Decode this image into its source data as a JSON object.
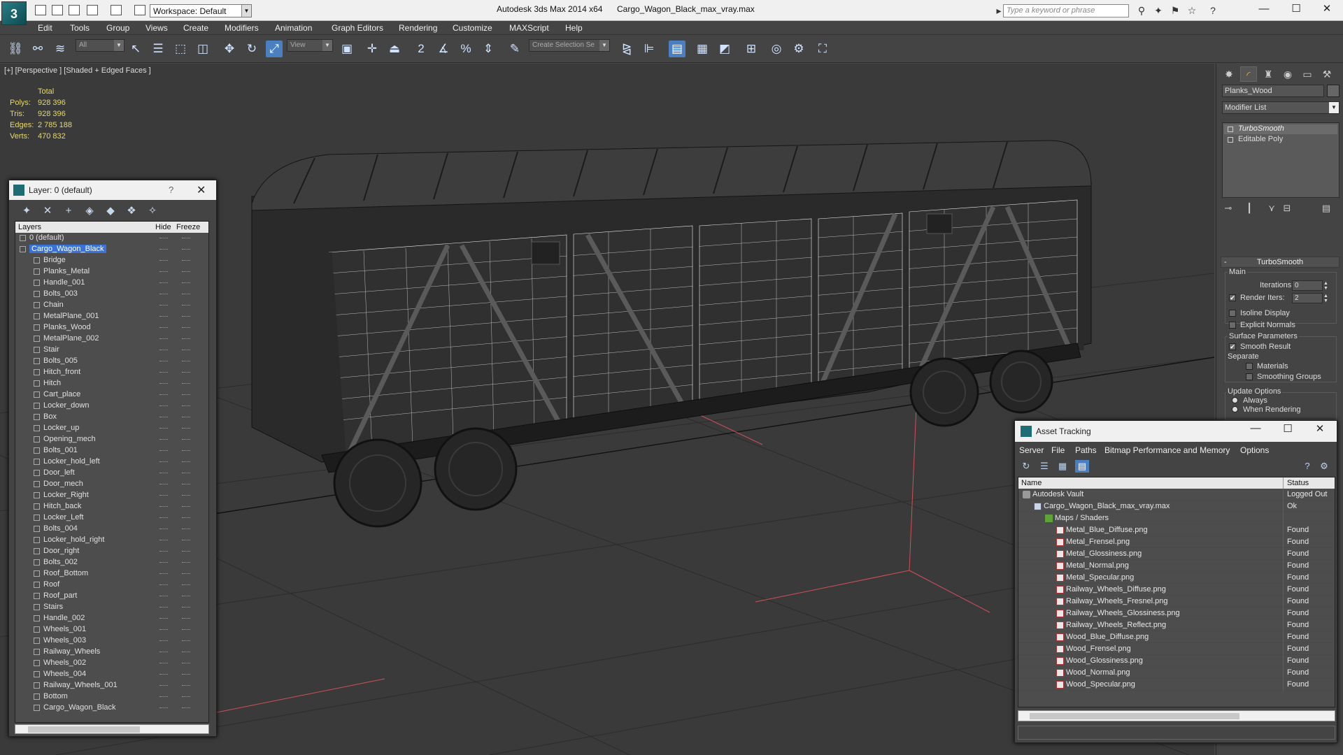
{
  "titlebar": {
    "workspace": "Workspace: Default",
    "app_title": "Autodesk 3ds Max 2014 x64",
    "file_name": "Cargo_Wagon_Black_max_vray.max",
    "search_placeholder": "Type a keyword or phrase"
  },
  "menu": [
    "Edit",
    "Tools",
    "Group",
    "Views",
    "Create",
    "Modifiers",
    "Animation",
    "Graph Editors",
    "Rendering",
    "Customize",
    "MAXScript",
    "Help"
  ],
  "toolbar": {
    "selection_filter": "All",
    "reference_coord": "View",
    "named_selection": "Create Selection Se"
  },
  "viewport": {
    "label": "[+] [Perspective ] [Shaded + Edged Faces ]",
    "stats_title": "Total",
    "stats": [
      {
        "key": "Polys:",
        "value": "928 396"
      },
      {
        "key": "Tris:",
        "value": "928 396"
      },
      {
        "key": "Edges:",
        "value": "2 785 188"
      },
      {
        "key": "Verts:",
        "value": "470 832"
      }
    ]
  },
  "layer_panel": {
    "title": "Layer: 0 (default)",
    "help": "?",
    "columns": {
      "layers": "Layers",
      "hide": "Hide",
      "freeze": "Freeze"
    },
    "rows": [
      {
        "name": "0 (default)",
        "level": 0,
        "selected": false
      },
      {
        "name": "Cargo_Wagon_Black",
        "level": 0,
        "selected": true
      },
      {
        "name": "Bridge",
        "level": 1
      },
      {
        "name": "Planks_Metal",
        "level": 1
      },
      {
        "name": "Handle_001",
        "level": 1
      },
      {
        "name": "Bolts_003",
        "level": 1
      },
      {
        "name": "Chain",
        "level": 1
      },
      {
        "name": "MetalPlane_001",
        "level": 1
      },
      {
        "name": "Planks_Wood",
        "level": 1
      },
      {
        "name": "MetalPlane_002",
        "level": 1
      },
      {
        "name": "Stair",
        "level": 1
      },
      {
        "name": "Bolts_005",
        "level": 1
      },
      {
        "name": "Hitch_front",
        "level": 1
      },
      {
        "name": "Hitch",
        "level": 1
      },
      {
        "name": "Cart_place",
        "level": 1
      },
      {
        "name": "Locker_down",
        "level": 1
      },
      {
        "name": "Box",
        "level": 1
      },
      {
        "name": "Locker_up",
        "level": 1
      },
      {
        "name": "Opening_mech",
        "level": 1
      },
      {
        "name": "Bolts_001",
        "level": 1
      },
      {
        "name": "Locker_hold_left",
        "level": 1
      },
      {
        "name": "Door_left",
        "level": 1
      },
      {
        "name": "Door_mech",
        "level": 1
      },
      {
        "name": "Locker_Right",
        "level": 1
      },
      {
        "name": "Hitch_back",
        "level": 1
      },
      {
        "name": "Locker_Left",
        "level": 1
      },
      {
        "name": "Bolts_004",
        "level": 1
      },
      {
        "name": "Locker_hold_right",
        "level": 1
      },
      {
        "name": "Door_right",
        "level": 1
      },
      {
        "name": "Bolts_002",
        "level": 1
      },
      {
        "name": "Roof_Bottom",
        "level": 1
      },
      {
        "name": "Roof",
        "level": 1
      },
      {
        "name": "Roof_part",
        "level": 1
      },
      {
        "name": "Stairs",
        "level": 1
      },
      {
        "name": "Handle_002",
        "level": 1
      },
      {
        "name": "Wheels_001",
        "level": 1
      },
      {
        "name": "Wheels_003",
        "level": 1
      },
      {
        "name": "Railway_Wheels",
        "level": 1
      },
      {
        "name": "Wheels_002",
        "level": 1
      },
      {
        "name": "Wheels_004",
        "level": 1
      },
      {
        "name": "Railway_Wheels_001",
        "level": 1
      },
      {
        "name": "Bottom",
        "level": 1
      },
      {
        "name": "Cargo_Wagon_Black",
        "level": 1
      }
    ]
  },
  "command_panel": {
    "object_name": "Planks_Wood",
    "modifier_list": "Modifier List",
    "stack": [
      "TurboSmooth",
      "Editable Poly"
    ],
    "rollout_title": "TurboSmooth",
    "main_group": "Main",
    "iterations_label": "Iterations:",
    "iterations_value": "0",
    "render_iters_label": "Render Iters:",
    "render_iters_value": "2",
    "render_iters_checked": "✔",
    "isoline_label": "Isoline Display",
    "explicit_normals_label": "Explicit Normals",
    "surface_params_label": "Surface Parameters",
    "smooth_result_label": "Smooth Result",
    "smooth_result_checked": "✔",
    "separate_label": "Separate",
    "materials_label": "Materials",
    "smoothing_groups_label": "Smoothing Groups",
    "update_options_label": "Update Options",
    "always_label": "Always",
    "when_rendering_label": "When Rendering"
  },
  "asset_tracking": {
    "title": "Asset Tracking",
    "menu": [
      "Server",
      "File",
      "Paths",
      "Bitmap Performance and Memory",
      "Options"
    ],
    "columns": {
      "name": "Name",
      "status": "Status"
    },
    "rows": [
      {
        "name": "Autodesk Vault",
        "status": "Logged Out",
        "type": "vault",
        "level": 0
      },
      {
        "name": "Cargo_Wagon_Black_max_vray.max",
        "status": "Ok",
        "type": "max",
        "level": 1
      },
      {
        "name": "Maps / Shaders",
        "status": "",
        "type": "maps",
        "level": 2
      },
      {
        "name": "Metal_Blue_Diffuse.png",
        "status": "Found",
        "type": "png",
        "level": 3
      },
      {
        "name": "Metal_Frensel.png",
        "status": "Found",
        "type": "png",
        "level": 3
      },
      {
        "name": "Metal_Glossiness.png",
        "status": "Found",
        "type": "png",
        "level": 3
      },
      {
        "name": "Metal_Normal.png",
        "status": "Found",
        "type": "png",
        "level": 3
      },
      {
        "name": "Metal_Specular.png",
        "status": "Found",
        "type": "png",
        "level": 3
      },
      {
        "name": "Railway_Wheels_Diffuse.png",
        "status": "Found",
        "type": "png",
        "level": 3
      },
      {
        "name": "Railway_Wheels_Fresnel.png",
        "status": "Found",
        "type": "png",
        "level": 3
      },
      {
        "name": "Railway_Wheels_Glossiness.png",
        "status": "Found",
        "type": "png",
        "level": 3
      },
      {
        "name": "Railway_Wheels_Reflect.png",
        "status": "Found",
        "type": "png",
        "level": 3
      },
      {
        "name": "Wood_Blue_Diffuse.png",
        "status": "Found",
        "type": "png",
        "level": 3
      },
      {
        "name": "Wood_Frensel.png",
        "status": "Found",
        "type": "png",
        "level": 3
      },
      {
        "name": "Wood_Glossiness.png",
        "status": "Found",
        "type": "png",
        "level": 3
      },
      {
        "name": "Wood_Normal.png",
        "status": "Found",
        "type": "png",
        "level": 3
      },
      {
        "name": "Wood_Specular.png",
        "status": "Found",
        "type": "png",
        "level": 3
      }
    ]
  },
  "colors": {
    "viewport_bg": "#3a3a3a",
    "panel_bg": "#444444",
    "stats_text": "#e8d86f",
    "selection_blue": "#3874d8",
    "grid_line": "#2a2a2a"
  }
}
